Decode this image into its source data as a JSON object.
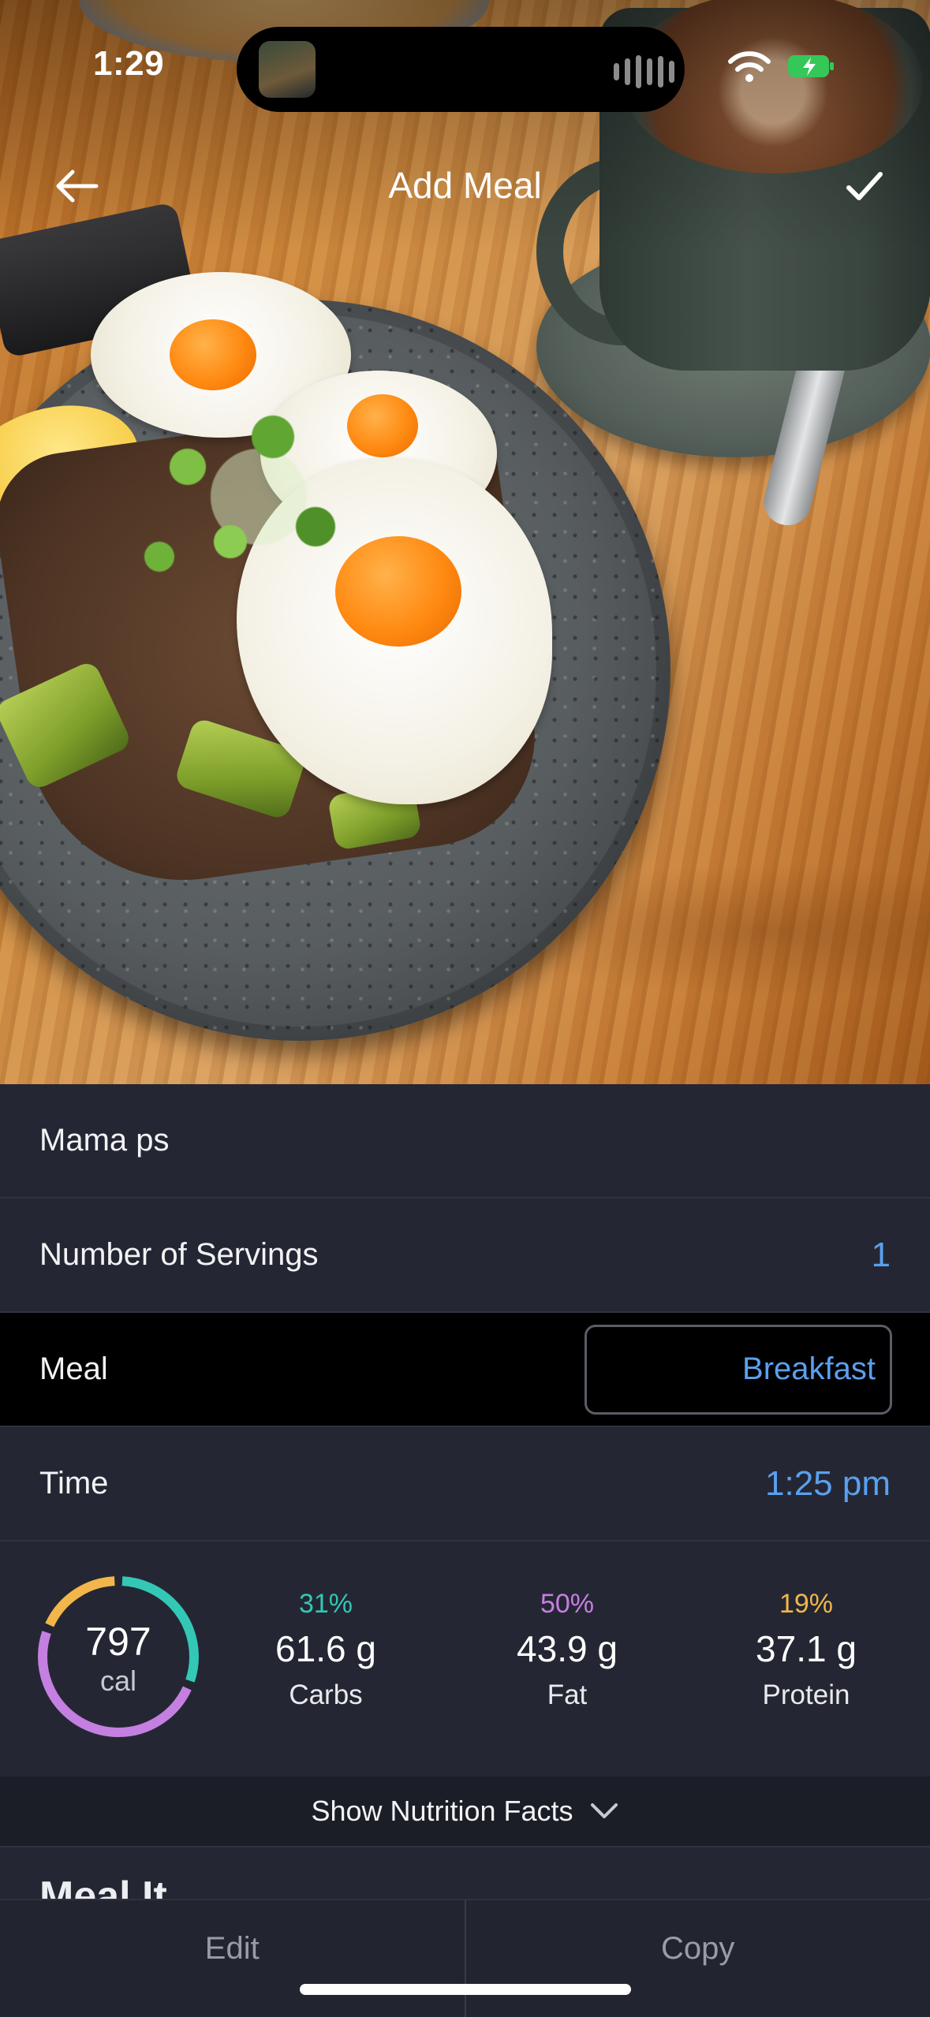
{
  "status_bar": {
    "time": "1:29"
  },
  "nav": {
    "title": "Add Meal"
  },
  "meal_form": {
    "name": "Mama ps",
    "servings_label": "Number of Servings",
    "servings_value": "1",
    "meal_label": "Meal",
    "meal_value": "Breakfast",
    "time_label": "Time",
    "time_value": "1:25 pm"
  },
  "summary": {
    "calories": "797",
    "calories_unit": "cal",
    "macros": [
      {
        "percent": "31%",
        "value": "61.6 g",
        "name": "Carbs",
        "color": "#33c7b6"
      },
      {
        "percent": "50%",
        "value": "43.9 g",
        "name": "Fat",
        "color": "#c57fe0"
      },
      {
        "percent": "19%",
        "value": "37.1 g",
        "name": "Protein",
        "color": "#f2b64a"
      }
    ]
  },
  "show_nutrition": {
    "label": "Show Nutrition Facts"
  },
  "peek_section": {
    "title": "Meal It"
  },
  "bottom_bar": {
    "edit_label": "Edit",
    "copy_label": "Copy"
  },
  "icons": {
    "back": "arrow-left-icon",
    "confirm": "checkmark-icon",
    "expand": "chevron-down-icon",
    "wifi": "wifi-icon",
    "battery": "battery-charging-icon"
  }
}
